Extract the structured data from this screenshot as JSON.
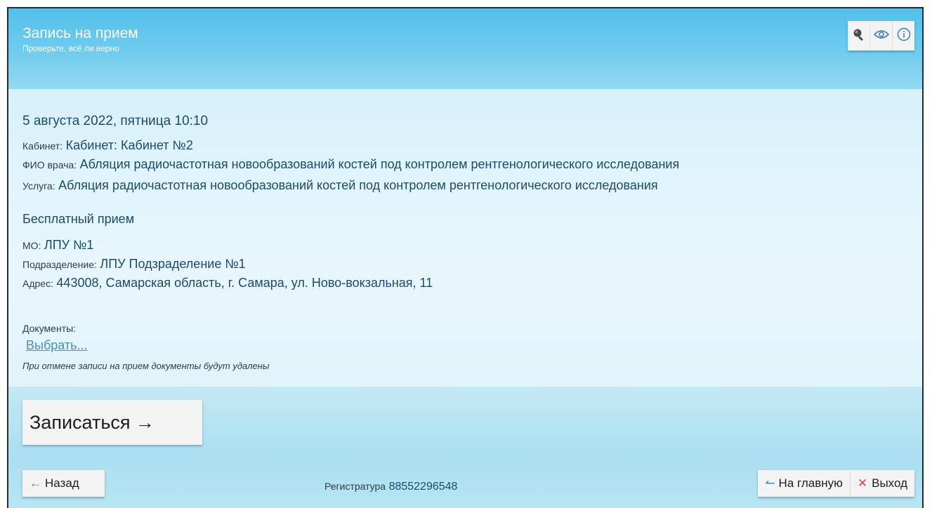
{
  "header": {
    "title": "Запись на прием",
    "subtitle": "Проверьте, всё ли верно"
  },
  "toolbar": {
    "icons": [
      "search-icon",
      "eye-icon",
      "info-icon"
    ],
    "accent": "#3b7fb5"
  },
  "appointment": {
    "datetime": "5 августа 2022, пятница 10:10",
    "cabinet_label": "Кабинет:",
    "cabinet_value": "Кабинет: Кабинет №2",
    "doctor_label": "ФИО врача:",
    "doctor_value": "Абляция радиочастотная новообразований костей под контролем рентгенологического исследования",
    "service_label": "Услуга:",
    "service_value": "Абляция радиочастотная новообразований костей под контролем рентгенологического исследования",
    "payment": "Бесплатный прием",
    "mo_label": "МО:",
    "mo_value": "ЛПУ №1",
    "department_label": "Подразделение:",
    "department_value": "ЛПУ Подзраделение №1",
    "address_label": "Адрес:",
    "address_value": "443008, Самарская область, г. Самара, ул. Ново-вокзальная, 11"
  },
  "documents": {
    "label": "Документы:",
    "choose_link": "Выбрать...",
    "note": "При отмене записи на прием документы будут удалены"
  },
  "actions": {
    "submit_label": "Записаться →"
  },
  "footer": {
    "back_label": "Назад",
    "registry_label": "Регистратура",
    "registry_phone": "88552296548",
    "home_label": "На главную",
    "exit_label": "Выход"
  },
  "colors": {
    "text_value": "#1b4a6e",
    "link": "#4a8fc0",
    "exit_icon": "#d9433b",
    "header_bg": "#53c0ea"
  }
}
